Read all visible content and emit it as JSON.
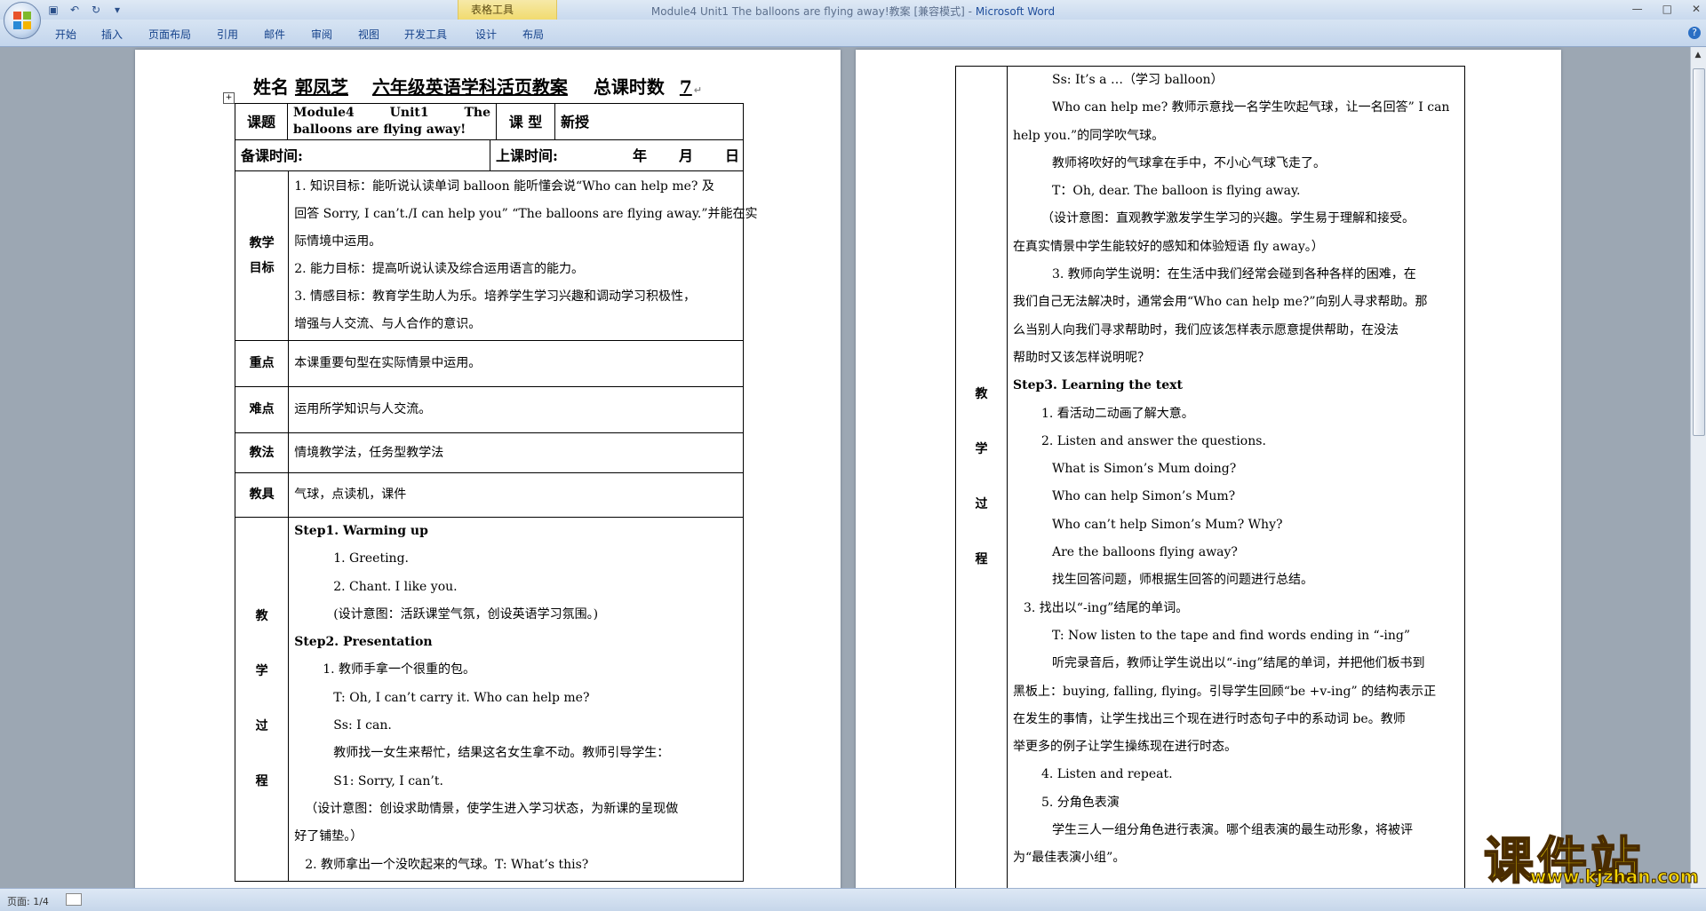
{
  "window": {
    "doc_name": "Module4 Unit1 The balloons are flying away!教案 [兼容模式] - ",
    "app_name": "Microsoft Word",
    "context_group": "表格工具",
    "controls": [
      "—",
      "□",
      "✕"
    ]
  },
  "ribbon": {
    "tabs": [
      "开始",
      "插入",
      "页面布局",
      "引用",
      "邮件",
      "审阅",
      "视图",
      "开发工具",
      "设计",
      "布局"
    ]
  },
  "status": {
    "pages": "页面: 1/4"
  },
  "watermark": {
    "main": "课件站",
    "url": "www.kjzhan.com"
  },
  "page1": {
    "heading": {
      "name_label": "姓名",
      "name": "郭凤芝",
      "grade_subject": "六年级英语学科活页教案",
      "total_label": "总课时数",
      "total": "7"
    },
    "topic_label": "课题",
    "topic": "Module4 Unit1 The balloons are flying away!",
    "type_label": "课 型",
    "type_value": "新授",
    "prep_label": "备课时间:",
    "class_label": "上课时间:",
    "date_year": "年",
    "date_month": "月",
    "date_day": "日",
    "goal_label": [
      "教学",
      "目标"
    ],
    "goals": [
      "1. 知识目标：能听说认读单词 balloon 能听懂会说“Who can help me? 及",
      "回答 Sorry, I can’t./I can help you” “The balloons are flying away.”并能在实",
      "际情境中运用。",
      "2. 能力目标：提高听说认读及综合运用语言的能力。",
      "3. 情感目标：教育学生助人为乐。培养学生学习兴趣和调动学习积极性，",
      "增强与人交流、与人合作的意识。"
    ],
    "key_label": "重点",
    "key": "本课重要句型在实际情景中运用。",
    "difficult_label": "难点",
    "difficult": "运用所学知识与人交流。",
    "method_label": "教法",
    "method": "情境教学法，任务型教学法",
    "tools_label": "教具",
    "tools": "气球，点读机，课件",
    "process_label": [
      "教",
      "学",
      "过",
      "程"
    ],
    "process": [
      "Step1. Warming up",
      "1.   Greeting.",
      "2.   Chant.   I like you.",
      "(设计意图：活跃课堂气氛，创设英语学习氛围。)",
      "Step2. Presentation",
      "1. 教师手拿一个很重的包。",
      "T: Oh, I can’t carry it. Who can help me?",
      "Ss: I can.",
      "教师找一女生来帮忙，结果这名女生拿不动。教师引导学生：",
      "S1: Sorry, I can’t.",
      "（设计意图：创设求助情景，使学生进入学习状态，为新课的呈现做",
      "好了铺垫。）",
      "2. 教师拿出一个没吹起来的气球。T: What’s this?"
    ]
  },
  "page2": {
    "process_label": [
      "教",
      "学",
      "过",
      "程"
    ],
    "lines": [
      "Ss: It’s a …（学习 balloon）",
      "Who can help me? 教师示意找一名学生吹起气球，让一名回答” I can",
      "help you.”的同学吹气球。",
      "教师将吹好的气球拿在手中，不小心气球飞走了。",
      "T：Oh, dear. The balloon is flying away.",
      "（设计意图：直观教学激发学生学习的兴趣。学生易于理解和接受。",
      "在真实情景中学生能较好的感知和体验短语 fly away。）",
      "3. 教师向学生说明：在生活中我们经常会碰到各种各样的困难，在",
      "我们自己无法解决时，通常会用“Who can help me?”向别人寻求帮助。那",
      "么当别人向我们寻求帮助时，我们应该怎样表示愿意提供帮助，在没法",
      "帮助时又该怎样说明呢？",
      "Step3. Learning the text",
      "1.   看活动二动画了解大意。",
      "2.   Listen and answer the questions.",
      "What is Simon’s Mum doing?",
      "Who can help Simon’s Mum?",
      "Who can’t help Simon’s Mum? Why?",
      "Are the balloons flying away?",
      "找生回答问题，师根据生回答的问题进行总结。",
      "3.   找出以“-ing”结尾的单词。",
      "T: Now listen to the tape and find words ending in “-ing”",
      "听完录音后，教师让学生说出以“-ing”结尾的单词，并把他们板书到",
      "黑板上：buying, falling, flying。引导学生回顾“be +v-ing” 的结构表示正",
      "在发生的事情，让学生找出三个现在进行时态句子中的系动词 be。教师",
      "举更多的例子让学生操练现在进行时态。",
      "4. Listen and repeat.",
      "5. 分角色表演",
      "学生三人一组分角色进行表演。哪个组表演的最生动形象，将被评",
      "为“最佳表演小组”。"
    ]
  }
}
